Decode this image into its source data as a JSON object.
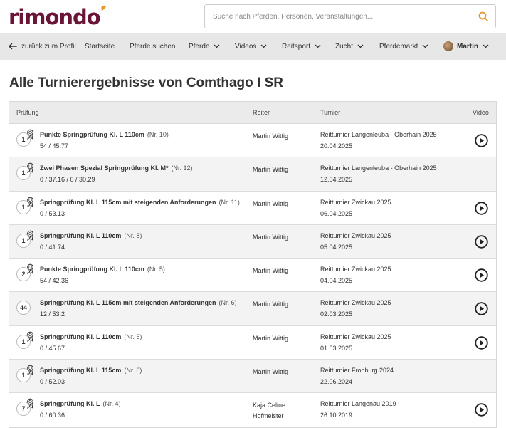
{
  "header": {
    "logo": "rimondo",
    "search_placeholder": "Suche nach Pferden, Personen, Veranstaltungen..."
  },
  "nav": {
    "back": "zurück zum Profil",
    "items": [
      {
        "label": "Startseite",
        "dropdown": false
      },
      {
        "label": "Pferde suchen",
        "dropdown": false
      },
      {
        "label": "Pferde",
        "dropdown": true
      },
      {
        "label": "Videos",
        "dropdown": true
      },
      {
        "label": "Reitsport",
        "dropdown": true
      },
      {
        "label": "Zucht",
        "dropdown": true
      },
      {
        "label": "Pferdemarkt",
        "dropdown": true
      }
    ],
    "user": "Martin"
  },
  "page_title": "Alle Turnierergebnisse von Comthago I SR",
  "table": {
    "headers": {
      "test": "Prüfung",
      "rider": "Reiter",
      "tournament": "Turnier",
      "video": "Video"
    },
    "rows": [
      {
        "place": "1",
        "ribbon": true,
        "test": "Punkte Springprüfung Kl. L 110cm",
        "nr": "(Nr. 10)",
        "score": "54 / 45.77",
        "rider": "Martin Wittig",
        "tournament": "Reitturnier Langenleuba - Oberhain 2025",
        "date": "20.04.2025",
        "video": true
      },
      {
        "place": "1",
        "ribbon": true,
        "test": "Zwei Phasen Spezial Springprüfung Kl. M*",
        "nr": "(Nr. 12)",
        "score": "0 / 37.16 / 0 / 30.29",
        "rider": "Martin Wittig",
        "tournament": "Reitturnier Langenleuba - Oberhain 2025",
        "date": "12.04.2025",
        "video": false
      },
      {
        "place": "1",
        "ribbon": true,
        "test": "Springprüfung Kl. L 115cm mit steigenden Anforderungen",
        "nr": "(Nr. 11)",
        "score": "0 / 53.13",
        "rider": "Martin Wittig",
        "tournament": "Reitturnier Zwickau 2025",
        "date": "06.04.2025",
        "video": true
      },
      {
        "place": "1",
        "ribbon": true,
        "test": "Springprüfung Kl. L 110cm",
        "nr": "(Nr. 8)",
        "score": "0 / 41.74",
        "rider": "Martin Wittig",
        "tournament": "Reitturnier Zwickau 2025",
        "date": "05.04.2025",
        "video": true
      },
      {
        "place": "2",
        "ribbon": true,
        "test": "Punkte Springprüfung Kl. L 110cm",
        "nr": "(Nr. 5)",
        "score": "54 / 42.36",
        "rider": "Martin Wittig",
        "tournament": "Reitturnier Zwickau 2025",
        "date": "04.04.2025",
        "video": true
      },
      {
        "place": "44",
        "ribbon": false,
        "test": "Springprüfung Kl. L 115cm mit steigenden Anforderungen",
        "nr": "(Nr. 6)",
        "score": "12 / 53.2",
        "rider": "Martin Wittig",
        "tournament": "Reitturnier Zwickau 2025",
        "date": "02.03.2025",
        "video": true
      },
      {
        "place": "1",
        "ribbon": true,
        "test": "Springprüfung Kl. L 110cm",
        "nr": "(Nr. 5)",
        "score": "0 / 45.67",
        "rider": "Martin Wittig",
        "tournament": "Reitturnier Zwickau 2025",
        "date": "01.03.2025",
        "video": true
      },
      {
        "place": "1",
        "ribbon": true,
        "test": "Springprüfung Kl. L 115cm",
        "nr": "(Nr. 6)",
        "score": "0 / 52.03",
        "rider": "Martin Wittig",
        "tournament": "Reitturnier Frohburg 2024",
        "date": "22.06.2024",
        "video": false
      },
      {
        "place": "7",
        "ribbon": true,
        "test": "Springprüfung Kl. L",
        "nr": "(Nr. 4)",
        "score": "0 / 60.36",
        "rider": "Kaja Celine Hofmeister",
        "tournament": "Reitturnier Langenau 2019",
        "date": "26.10.2019",
        "video": true
      }
    ]
  },
  "colors": {
    "brand": "#6a1538",
    "accent": "#e8962a",
    "nav_bg": "#e7e7e7"
  }
}
